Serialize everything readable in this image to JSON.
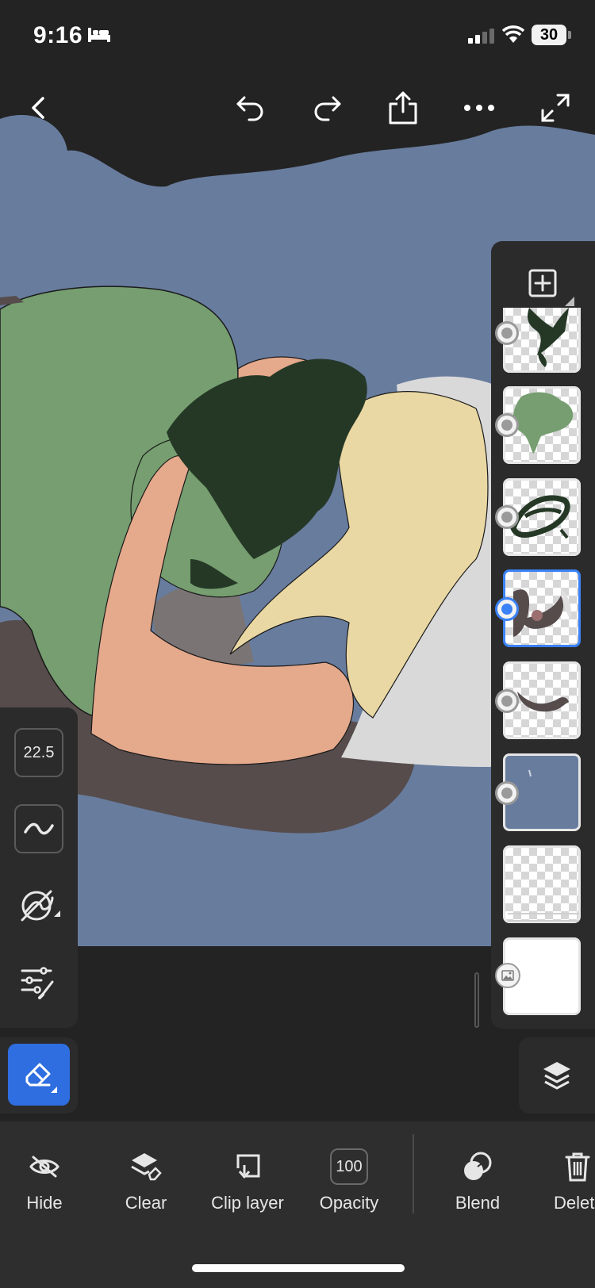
{
  "status_bar": {
    "time": "9:16",
    "battery": "30"
  },
  "toolbar": {
    "back": "back-icon",
    "undo": "undo-icon",
    "redo": "redo-icon",
    "share": "share-icon",
    "more": "more-icon",
    "fullscreen": "expand-icon"
  },
  "left_tools": {
    "brush_size": "22.5"
  },
  "layers": {
    "count": 8,
    "selected_index": 3,
    "items": [
      {
        "content": "dark green hair strokes"
      },
      {
        "content": "green skin fill"
      },
      {
        "content": "dark green hair scribble"
      },
      {
        "content": "shadow strokes"
      },
      {
        "content": "brown stroke"
      },
      {
        "content": "blue background fill"
      },
      {
        "content": "empty layer"
      },
      {
        "content": "background image"
      }
    ]
  },
  "bottom_bar": {
    "hide": "Hide",
    "clear": "Clear",
    "clip_layer": "Clip layer",
    "opacity_value": "100",
    "opacity": "Opacity",
    "blend": "Blend",
    "delete": "Delete"
  },
  "colors": {
    "accent": "#2f6ee0",
    "canvas_bg": "#687c9e",
    "panel": "#2b2b2b",
    "skin_green": "#769e70",
    "skin_peach": "#e5a98c",
    "hair_blonde": "#ead8a4",
    "hair_dark": "#253826",
    "pillow": "#d9d9d9",
    "shadow": "#564c4c"
  }
}
